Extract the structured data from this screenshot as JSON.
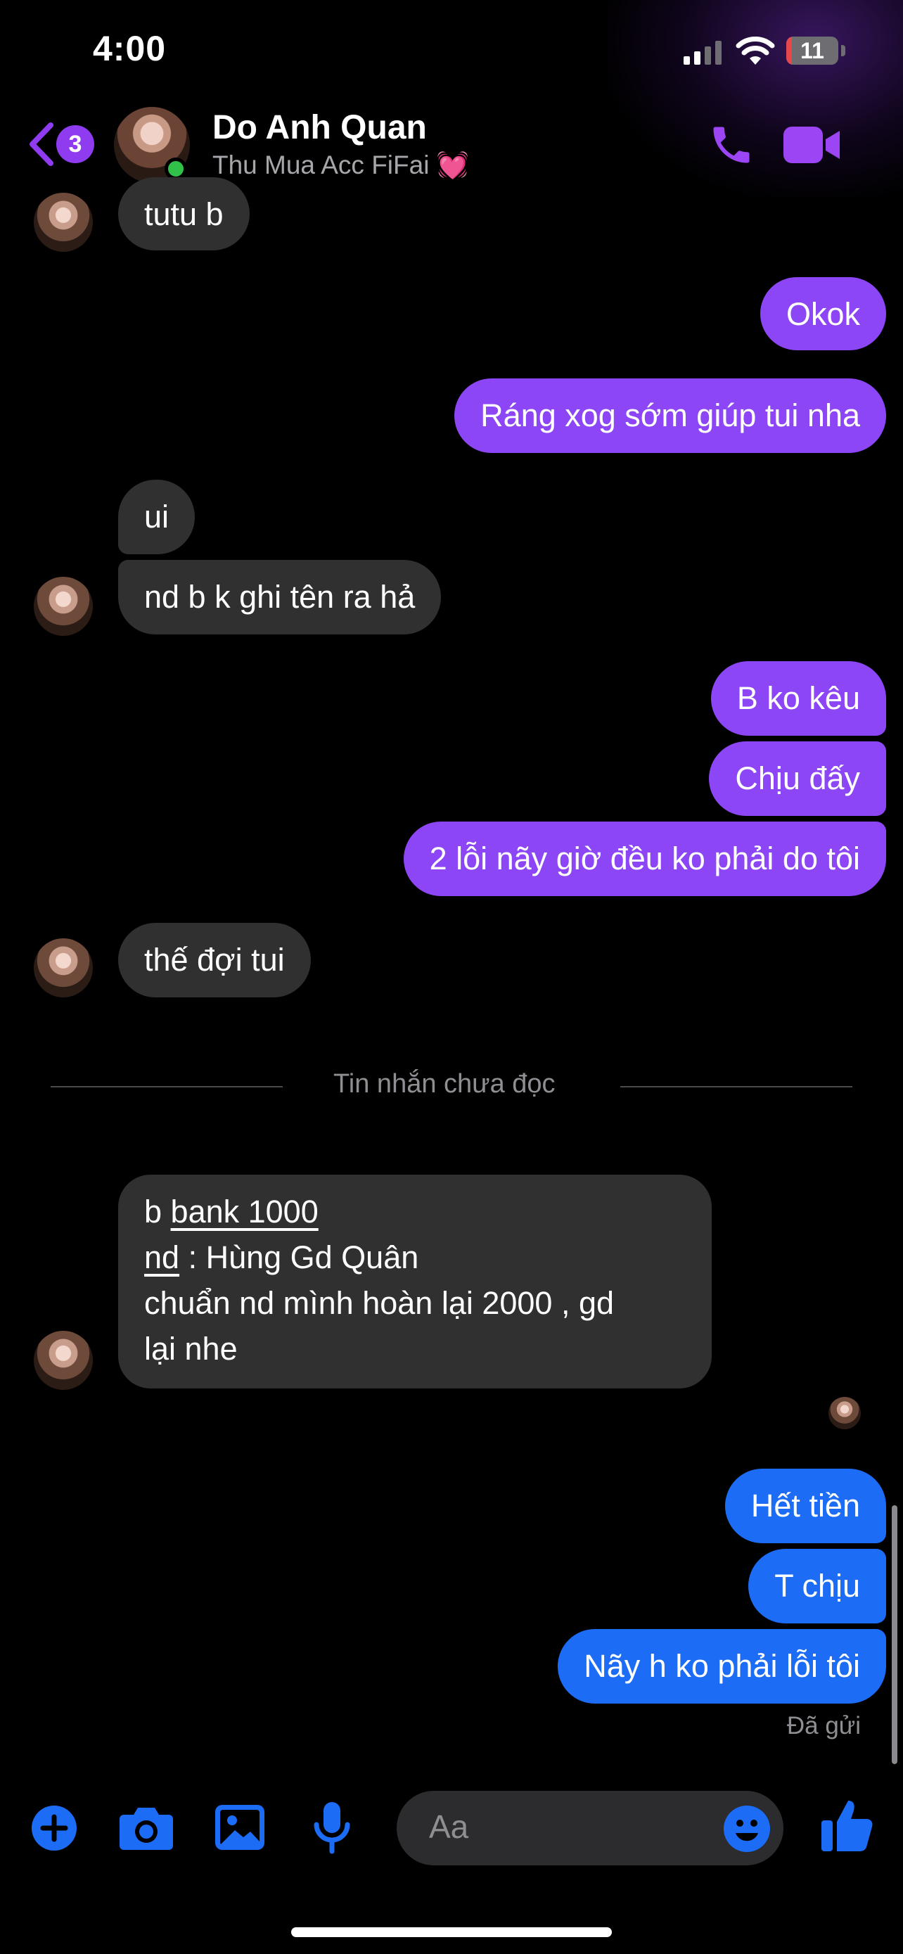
{
  "status_bar": {
    "time": "4:00",
    "battery": "11",
    "battery_level": 0.11
  },
  "header": {
    "unread_count": "3",
    "contact_name": "Do Anh Quan",
    "contact_subtitle": "Thu Mua Acc FiFai 💓"
  },
  "messages": [
    {
      "text": "tutu b",
      "from": "them"
    },
    {
      "text": "Okok",
      "from": "me"
    },
    {
      "text": "Ráng xog sớm giúp tui nha",
      "from": "me"
    },
    {
      "text": "ui",
      "from": "them"
    },
    {
      "text": "nd b k ghi tên ra hả",
      "from": "them"
    },
    {
      "text": "B ko kêu",
      "from": "me"
    },
    {
      "text": "Chịu đấy",
      "from": "me"
    },
    {
      "text": "2 lỗi nãy giờ đều ko phải do tôi",
      "from": "me"
    },
    {
      "text": "thế đợi tui",
      "from": "them"
    },
    {
      "from": "them",
      "lines": [
        "b",
        "bank 1000",
        "nd",
        " : Hùng Gd Quân",
        "chuẩn nd mình hoàn lại 2000 , gd",
        "lại nhe"
      ]
    },
    {
      "text": "Hết tiền",
      "from": "me"
    },
    {
      "text": "T chịu",
      "from": "me"
    },
    {
      "text": "Nãy h ko phải lỗi tôi",
      "from": "me"
    }
  ],
  "unread_divider": "Tin nhắn chưa đọc",
  "sent_status": "Đã gửi",
  "composer": {
    "placeholder": "Aa"
  },
  "icons": [
    "back-chevron-icon",
    "phone-icon",
    "video-camera-icon",
    "plus-icon",
    "camera-icon",
    "image-icon",
    "microphone-icon",
    "emoji-icon",
    "thumbs-up-icon"
  ],
  "colors": {
    "accent_purple": "#8d46f5",
    "accent_blue": "#1c6cf5",
    "incoming_bubble": "#303030",
    "online": "#31c14a"
  }
}
